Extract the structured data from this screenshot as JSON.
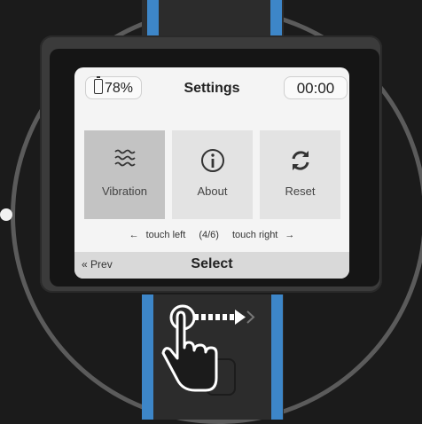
{
  "screen": {
    "battery": "78%",
    "title": "Settings",
    "timer": "00:00"
  },
  "tiles": [
    {
      "label": "Vibration",
      "icon": "vibration-icon",
      "selected": true
    },
    {
      "label": "About",
      "icon": "info-icon",
      "selected": false
    },
    {
      "label": "Reset",
      "icon": "reset-icon",
      "selected": false
    }
  ],
  "nav_hint": {
    "left": "touch left",
    "page": "(4/6)",
    "right": "touch right"
  },
  "bottom_bar": {
    "prev": "Prev",
    "select": "Select"
  },
  "colors": {
    "strap_accent": "#3d86c8",
    "selected_tile": "#c3c3c3"
  }
}
